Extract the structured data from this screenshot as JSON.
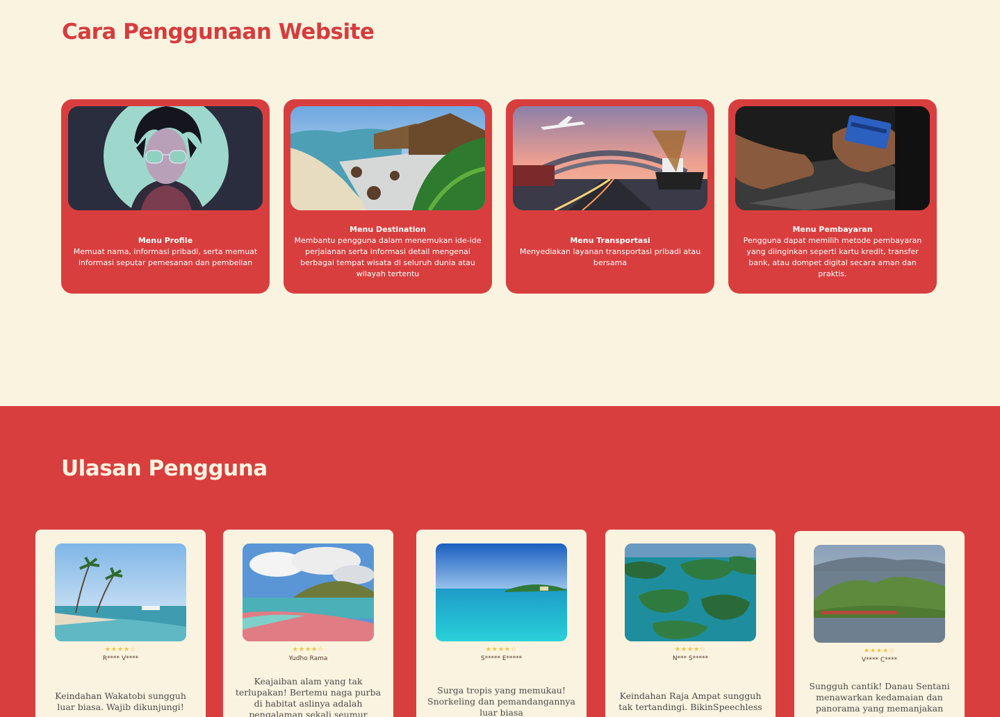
{
  "usage": {
    "title": "Cara Penggunaan Website",
    "cards": [
      {
        "title": "Menu Profile",
        "desc": "Memuat  nama, informasi pribadi, serta memuat informasi seputar pemesanan dan pembelian",
        "image": "profile-avatar-illustration"
      },
      {
        "title": "Menu Destination",
        "desc": "Membantu pengguna dalam menemukan ide-ide perjalanan serta informasi detail mengenai berbagai tempat wisata di seluruh dunia atau wilayah tertentu",
        "image": "beach-resort-photo"
      },
      {
        "title": "Menu Transportasi",
        "desc": "Menyediakan layanan transportasi pribadi atau bersama",
        "image": "transportation-photo"
      },
      {
        "title": "Menu Pembayaran",
        "desc": "Pengguna dapat memilih metode pembayaran yang diinginkan seperti kartu kredit, transfer bank, atau dompet digital secara aman dan praktis.",
        "image": "credit-card-payment-photo"
      }
    ]
  },
  "reviews": {
    "title": "Ulasan Pengguna",
    "items": [
      {
        "stars": "★★★★☆",
        "rating": 4,
        "name": "R**** V****",
        "text": "Keindahan Wakatobi sungguh luar biasa. Wajib dikunjungi!",
        "image": "wakatobi-beach-photo"
      },
      {
        "stars": "★★★★☆",
        "rating": 4,
        "name": "Yudho Rama",
        "text": "Keajaiban alam yang tak terlupakan! Bertemu naga purba di habitat aslinya adalah pengalaman sekali seumur hidup.",
        "image": "pink-beach-komodo-photo"
      },
      {
        "stars": "★★★★☆",
        "rating": 4,
        "name": "S***** E*****",
        "text": "Surga tropis yang memukau! Snorkeling dan pemandangannya luar biasa",
        "image": "gili-island-photo"
      },
      {
        "stars": "★★★★☆",
        "rating": 4,
        "name": "N*** S*****",
        "text": "Keindahan Raja Ampat sungguh tak tertandingi. BikinSpeechless",
        "image": "raja-ampat-photo"
      },
      {
        "stars": "★★★★☆",
        "rating": 4,
        "name": "V**** C****",
        "text": "Sungguh cantik! Danau Sentani menawarkan kedamaian dan panorama yang memanjakan mata",
        "image": "danau-sentani-photo"
      }
    ]
  },
  "colors": {
    "cream": "#FAF3E0",
    "red": "#D93E3E",
    "title_red": "#D63C3D",
    "star": "#F2C233"
  }
}
